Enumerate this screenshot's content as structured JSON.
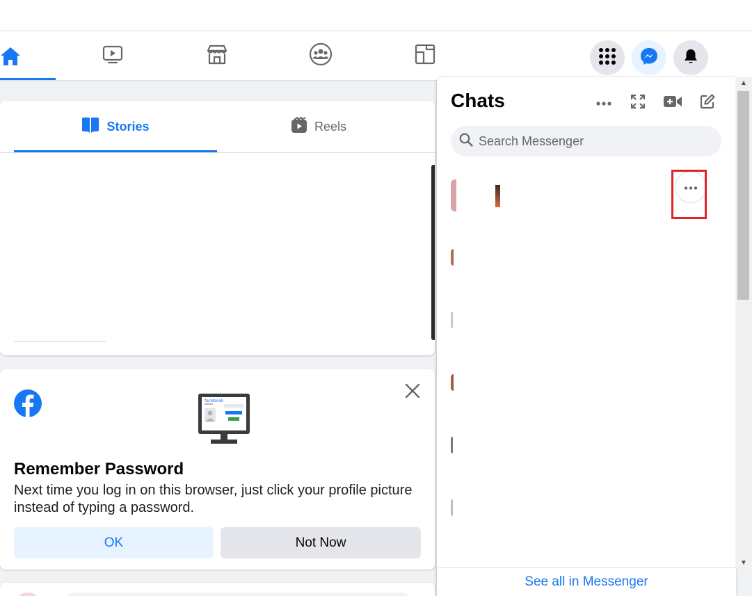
{
  "nav": {
    "tabs": [
      {
        "name": "home-icon",
        "active": true
      },
      {
        "name": "watch-icon",
        "active": false
      },
      {
        "name": "marketplace-icon",
        "active": false
      },
      {
        "name": "groups-icon",
        "active": false
      },
      {
        "name": "gaming-icon",
        "active": false
      }
    ],
    "right_buttons": [
      "menu-grid-icon",
      "messenger-icon",
      "notifications-icon"
    ]
  },
  "stories": {
    "tabs": [
      {
        "label": "Stories",
        "icon": "book-icon",
        "active": true
      },
      {
        "label": "Reels",
        "icon": "reels-icon",
        "active": false
      }
    ]
  },
  "remember_password": {
    "title": "Remember Password",
    "description": "Next time you log in on this browser, just click your profile picture instead of typing a password.",
    "ok_label": "OK",
    "not_now_label": "Not Now",
    "screen_brand": "facebook"
  },
  "chats": {
    "title": "Chats",
    "search_placeholder": "Search Messenger",
    "see_all_label": "See all in Messenger",
    "header_icons": [
      "more-options-icon",
      "expand-icon",
      "new-video-call-icon",
      "new-message-icon"
    ]
  },
  "colors": {
    "accent": "#1877f2",
    "highlight": "#e0242a",
    "background": "#f0f2f5"
  }
}
